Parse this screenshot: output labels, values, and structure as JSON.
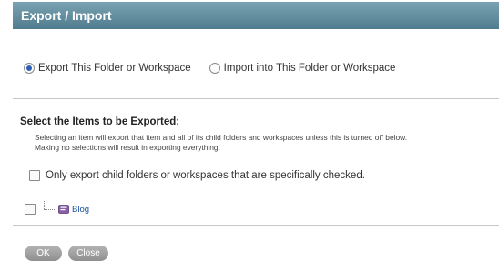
{
  "header": {
    "title": "Export / Import"
  },
  "mode": {
    "options": [
      {
        "label": "Export This Folder or Workspace",
        "selected": true
      },
      {
        "label": "Import into This Folder or Workspace",
        "selected": false
      }
    ]
  },
  "export_section": {
    "title": "Select the Items to be Exported:",
    "description_line1": "Selecting an item will export that item and all of its child folders and workspaces unless this is turned off below.",
    "description_line2": "Making no selections will result in exporting everything.",
    "only_checked_label": "Only export child folders or workspaces that are specifically checked.",
    "only_checked": false
  },
  "tree": {
    "items": [
      {
        "label": "Blog",
        "checked": false,
        "icon": "blog-icon"
      }
    ]
  },
  "buttons": {
    "ok_label": "OK",
    "close_label": "Close"
  },
  "colors": {
    "header_top": "#7aa3b2",
    "header_bottom": "#4f7c8e",
    "link": "#1a4fa0",
    "radio_dot": "#2f5fb5"
  }
}
